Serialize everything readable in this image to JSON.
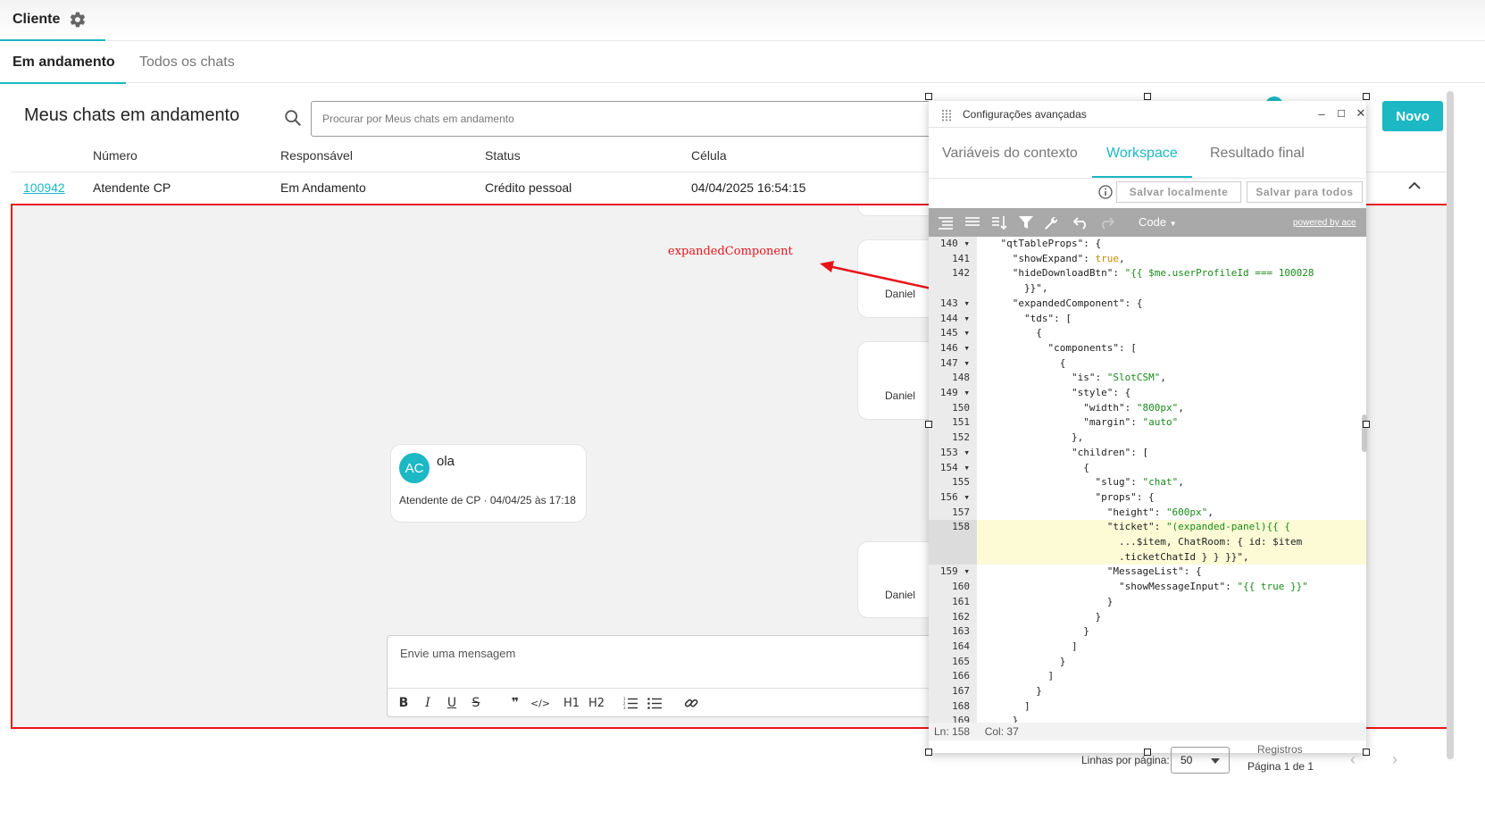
{
  "header": {
    "tab_label": "Cliente",
    "gear_icon": "gear-icon"
  },
  "subtabs": {
    "active": "Em andamento",
    "inactive": "Todos os chats"
  },
  "section": {
    "title": "Meus chats em andamento",
    "search_placeholder": "Procurar por Meus chats em andamento",
    "new_button": "Novo"
  },
  "table": {
    "columns": [
      "Número",
      "Responsável",
      "Status",
      "Célula"
    ],
    "row": {
      "number": "100942",
      "responsible": "Atendente CP",
      "status": "Em Andamento",
      "cell": "Crédito pessoal",
      "date": "04/04/2025 16:54:15"
    }
  },
  "chat": {
    "right_author": "Daniel",
    "left_message": {
      "avatar": "AC",
      "text": "ola",
      "meta": "Atendente de CP · 04/04/25 às 17:18"
    },
    "composer_placeholder": "Envie uma mensagem",
    "toolbar": [
      "B",
      "I",
      "U",
      "S",
      "❞",
      "</>",
      "H1",
      "H2",
      "ol",
      "ul",
      "link"
    ]
  },
  "annotation": {
    "label": "expandedComponent",
    "color": "#e8141b"
  },
  "dialog": {
    "title": "Configurações avançadas",
    "tabs": [
      "Variáveis do contexto",
      "Workspace",
      "Resultado final"
    ],
    "save_local": "Salvar localmente",
    "save_all": "Salvar para todos",
    "code_dropdown": "Code",
    "powered_by": "powered by ace",
    "status": {
      "line": "Ln: 158",
      "col": "Col: 37"
    },
    "gutter": [
      {
        "n": "140",
        "fold": true
      },
      {
        "n": "141"
      },
      {
        "n": "142"
      },
      {
        "n": ""
      },
      {
        "n": "143",
        "fold": true
      },
      {
        "n": "144",
        "fold": true
      },
      {
        "n": "145",
        "fold": true
      },
      {
        "n": "146",
        "fold": true
      },
      {
        "n": "147",
        "fold": true
      },
      {
        "n": "148"
      },
      {
        "n": "149",
        "fold": true
      },
      {
        "n": "150"
      },
      {
        "n": "151"
      },
      {
        "n": "152"
      },
      {
        "n": "153",
        "fold": true
      },
      {
        "n": "154",
        "fold": true
      },
      {
        "n": "155"
      },
      {
        "n": "156",
        "fold": true
      },
      {
        "n": "157"
      },
      {
        "n": "158",
        "active": true
      },
      {
        "n": "",
        "active": true
      },
      {
        "n": "",
        "active": true
      },
      {
        "n": "159",
        "fold": true
      },
      {
        "n": "160"
      },
      {
        "n": "161"
      },
      {
        "n": "162"
      },
      {
        "n": "163"
      },
      {
        "n": "164"
      },
      {
        "n": "165"
      },
      {
        "n": "166"
      },
      {
        "n": "167"
      },
      {
        "n": "168"
      },
      {
        "n": "169"
      }
    ],
    "code_lines": [
      "    \"qtTableProps\": {",
      "      \"showExpand\": true,",
      "      \"hideDownloadBtn\": \"{{ $me.userProfileId === 100028",
      "        }}\",",
      "      \"expandedComponent\": {",
      "        \"tds\": [",
      "          {",
      "            \"components\": [",
      "              {",
      "                \"is\": \"SlotCSM\",",
      "                \"style\": {",
      "                  \"width\": \"800px\",",
      "                  \"margin\": \"auto\"",
      "                },",
      "                \"children\": [",
      "                  {",
      "                    \"slug\": \"chat\",",
      "                    \"props\": {",
      "                      \"height\": \"600px\",",
      "                      \"ticket\": \"(expanded-panel){{ {",
      "                        ...$item, ChatRoom: { id: $item",
      "                        .ticketChatId } } }}\",",
      "                      \"MessageList\": {",
      "                        \"showMessageInput\": \"{{ true }}\"",
      "                      }",
      "                    }",
      "                  }",
      "                ]",
      "              }",
      "            ]",
      "          }",
      "        ]",
      "      }"
    ]
  },
  "footer": {
    "rows_label": "Linhas por página:",
    "rows_value": "50",
    "records": "Registros",
    "page": "Página 1 de 1"
  }
}
